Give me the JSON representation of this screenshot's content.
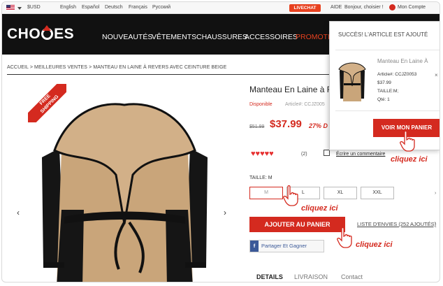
{
  "topbar": {
    "currency": "$USD",
    "languages": [
      "English",
      "Español",
      "Deutsch",
      "Français",
      "Русский"
    ],
    "livechat": "LIVECHAT",
    "aide": "AIDE",
    "greeting": "Bonjour, choisier !",
    "account": "Mon Compte"
  },
  "header": {
    "logo": "CHO  ES",
    "nav": [
      "NOUVEAUTÉS",
      "VÊTEMENTS",
      "CHAUSSURES",
      "ACCESSOIRES",
      "PROMOTIO"
    ],
    "accent_color": "#d42a1f",
    "background_color": "#111111"
  },
  "breadcrumb": "ACCUEIL > MEILLEURES VENTES > MANTEAU EN LAINE À REVERS AVEC CEINTURE BEIGE",
  "product": {
    "ribbon": "FREE\nSHIPPING",
    "title": "Manteau En Laine à R",
    "availability": "Disponible",
    "article": "Article#: CCJZ005",
    "old_price": "$51.99",
    "price": "$37.99",
    "discount": "27% D",
    "rating_count": "(2)",
    "write_review": "Écrire un commentaire",
    "size_label": "TAILLE: M",
    "sizes": [
      "M",
      "L",
      "XL",
      "XXL"
    ],
    "selected_size": "M",
    "add_to_cart": "AJOUTER AU PANIER",
    "wishlist": "LISTE D'ENVIES (252 AJOUTÉS)",
    "share": "Partager Et Gagner",
    "tabs": [
      "DETAILS",
      "LIVRAISON",
      "Contact"
    ]
  },
  "popup": {
    "success": "SUCCÈS! L'ARTICLE EST AJOUTÉ",
    "item_name": "Manteau En Laine À",
    "article": "Article#: CCJZ0053",
    "price": "$37.99",
    "size": "TAILLE:M;",
    "qty": "Qté: 1",
    "view_cart": "VOIR MON PANIER"
  },
  "annotations": {
    "cliquez_1": "cliquez ici",
    "cliquez_2": "cliquez ici",
    "cliquez_3": "cliquez ici"
  }
}
